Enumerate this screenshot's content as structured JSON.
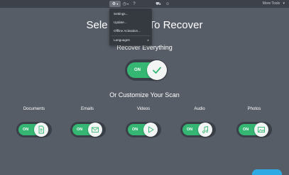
{
  "toolbar": {
    "more_tools": "More Tools"
  },
  "settings_menu": {
    "items": [
      {
        "label": "Settings..."
      },
      {
        "label": "Update..."
      },
      {
        "label": "Offline Activation..."
      },
      {
        "label": "Languages"
      }
    ]
  },
  "main": {
    "title_left": "Sele",
    "title_right": "To Recover",
    "recover_everything": "Recover Everything",
    "customize": "Or Customize Your Scan",
    "main_toggle": {
      "state_label": "ON"
    },
    "categories": [
      {
        "label": "Documents",
        "state_label": "ON",
        "icon": "document-icon"
      },
      {
        "label": "Emails",
        "state_label": "ON",
        "icon": "email-icon"
      },
      {
        "label": "Videos",
        "state_label": "ON",
        "icon": "play-icon"
      },
      {
        "label": "Audio",
        "state_label": "ON",
        "icon": "music-note-icon"
      },
      {
        "label": "Photos",
        "state_label": "ON",
        "icon": "image-icon"
      }
    ]
  },
  "colors": {
    "background": "#575d67",
    "toolbar": "#3d424a",
    "toggle_on": "#35b673",
    "accent_button": "#2fa9e4"
  }
}
